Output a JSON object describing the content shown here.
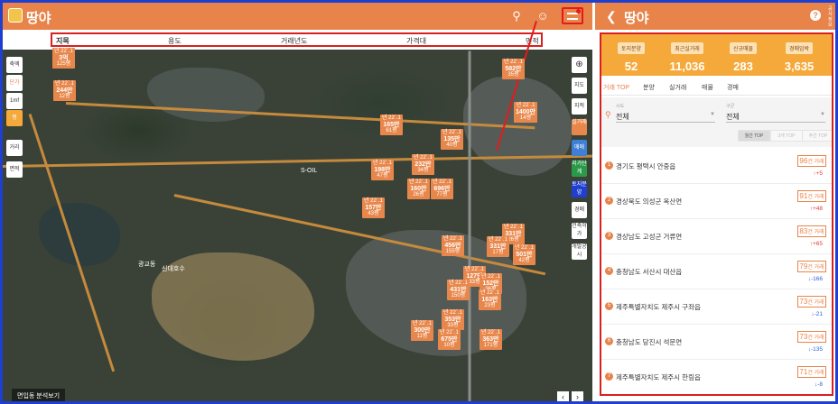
{
  "left": {
    "brand": "땅야",
    "icons": {
      "search": "search-icon",
      "user": "user-icon",
      "filter": "filter-icon"
    },
    "columns": [
      "지목",
      "용도",
      "거래년도",
      "가격대",
      "면적"
    ],
    "left_tools": [
      "축액",
      "단가",
      "1mf",
      "평",
      "거리",
      "면적"
    ],
    "right_tools": [
      "지도",
      "지적",
      "실거래",
      "매매",
      "지가단계",
      "토지분양",
      "경매",
      "건축허가",
      "개발공시"
    ],
    "markers": [
      {
        "date": "년 22`.1",
        "price": "3억",
        "sub": "125평"
      },
      {
        "date": "년 22`.1",
        "price": "244만",
        "sub": "12평"
      },
      {
        "date": "년 22`.1",
        "price": "582만",
        "sub": "35평"
      },
      {
        "date": "년 22`.1",
        "price": "1400만",
        "sub": "14평"
      },
      {
        "date": "년 22`.1",
        "price": "165만",
        "sub": "61평"
      },
      {
        "date": "년 22`.1",
        "price": "135만",
        "sub": "40평"
      },
      {
        "date": "년 22`.1",
        "price": "198만",
        "sub": "47평"
      },
      {
        "date": "년 22`.1",
        "price": "232만",
        "sub": "34평"
      },
      {
        "date": "년 22`.1",
        "price": "160만",
        "sub": "26평"
      },
      {
        "date": "년 22`.1",
        "price": "696만",
        "sub": "77평"
      },
      {
        "date": "년 22`.1",
        "price": "157만",
        "sub": "43평"
      },
      {
        "date": "년 22`.1",
        "price": "331만",
        "sub": "26평"
      },
      {
        "date": "년 22`.1",
        "price": "456만",
        "sub": "155평"
      },
      {
        "date": "년 22`.1",
        "price": "331만",
        "sub": "17평"
      },
      {
        "date": "년 22`.1",
        "price": "501만",
        "sub": "42평"
      },
      {
        "date": "년 22`.1",
        "price": "127만",
        "sub": "33평"
      },
      {
        "date": "년 22`.1",
        "price": "431만",
        "sub": "150평"
      },
      {
        "date": "년 22`.1",
        "price": "152만",
        "sub": "36평"
      },
      {
        "date": "년 22`.1",
        "price": "163만",
        "sub": "23평"
      },
      {
        "date": "년 22`.1",
        "price": "353만",
        "sub": "33평"
      },
      {
        "date": "년 22`.1",
        "price": "300만",
        "sub": "11평"
      },
      {
        "date": "년 22`.1",
        "price": "675만",
        "sub": "10평"
      },
      {
        "date": "년 22`.1",
        "price": "363만",
        "sub": "171평"
      }
    ],
    "map_labels": [
      "S-OIL",
      "신대호수",
      "광교동"
    ],
    "bottom_text": "면입동 분석보기"
  },
  "right": {
    "brand": "땅야",
    "side_text": "공 사 정 보",
    "stats": [
      {
        "label": "토지분양",
        "value": "52"
      },
      {
        "label": "최근실거래",
        "value": "11,036"
      },
      {
        "label": "신규매물",
        "value": "283"
      },
      {
        "label": "경매임박",
        "value": "3,635"
      }
    ],
    "tabs": [
      "거래 TOP",
      "분양",
      "실거래",
      "매물",
      "경매"
    ],
    "filters": {
      "sido_caption": "시도",
      "sido_value": "전체",
      "gugun_caption": "구군",
      "gugun_value": "전체",
      "buttons": [
        "월간 TOP",
        "3개 TOP",
        "주간 TOP"
      ]
    },
    "ranking": [
      {
        "rank": "1",
        "region": "경기도 평택시 안중읍",
        "count": "96",
        "unit": "건 거래",
        "change": "+5",
        "dir": "up"
      },
      {
        "rank": "2",
        "region": "경상북도 의성군 옥산면",
        "count": "91",
        "unit": "건 거래",
        "change": "+48",
        "dir": "up"
      },
      {
        "rank": "3",
        "region": "경상남도 고성군 거류면",
        "count": "83",
        "unit": "건 거래",
        "change": "+65",
        "dir": "up"
      },
      {
        "rank": "4",
        "region": "충청남도 서산시 대산읍",
        "count": "79",
        "unit": "건 거래",
        "change": "-166",
        "dir": "down"
      },
      {
        "rank": "5",
        "region": "제주특별자치도 제주시 구좌읍",
        "count": "73",
        "unit": "건 거래",
        "change": "-21",
        "dir": "down"
      },
      {
        "rank": "6",
        "region": "충청남도 당진시 석문면",
        "count": "73",
        "unit": "건 거래",
        "change": "-135",
        "dir": "down"
      },
      {
        "rank": "7",
        "region": "제주특별자치도 제주시 한림읍",
        "count": "71",
        "unit": "건 거래",
        "change": "-8",
        "dir": "down"
      }
    ]
  }
}
